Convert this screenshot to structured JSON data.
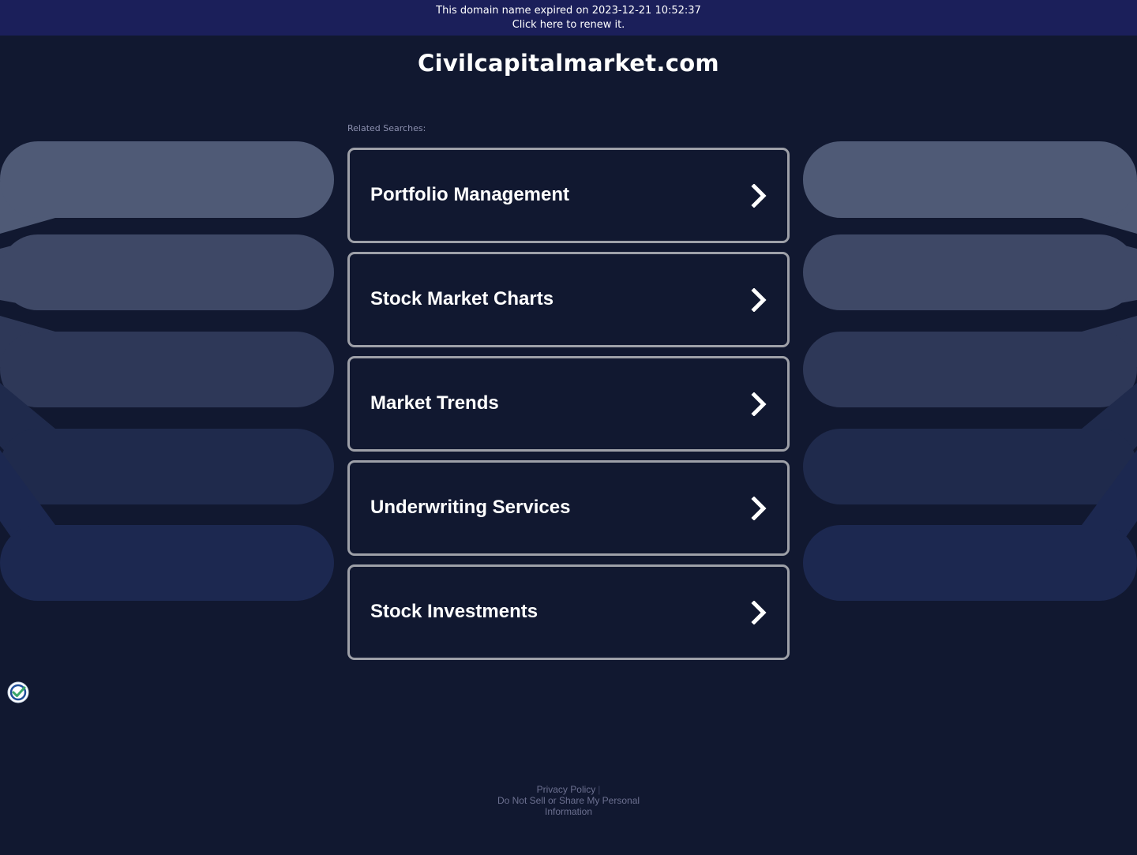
{
  "banner": {
    "line1": "This domain name expired on 2023-12-21 10:52:37",
    "line2": "Click here to renew it."
  },
  "site": {
    "title": "Civilcapitalmarket.com"
  },
  "related": {
    "label": "Related Searches:",
    "items": [
      {
        "label": "Portfolio Management"
      },
      {
        "label": "Stock Market Charts"
      },
      {
        "label": "Market Trends"
      },
      {
        "label": "Underwriting Services"
      },
      {
        "label": "Stock Investments"
      }
    ]
  },
  "footer": {
    "privacy": "Privacy Policy",
    "separator": "|",
    "do_not_sell": "Do Not Sell or Share My Personal Information"
  },
  "icons": {
    "card_arrow": "chevron-right-icon",
    "badge": "privacy-check-icon"
  },
  "colors": {
    "background": "#111830",
    "banner": "#1b1f5a",
    "card_border": "#9ea0a8"
  }
}
